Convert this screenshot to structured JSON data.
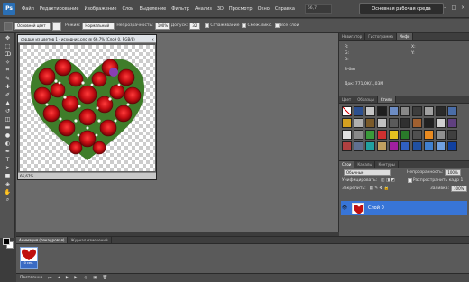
{
  "app": {
    "logo": "Ps"
  },
  "menu": [
    "Файл",
    "Редактирование",
    "Изображение",
    "Слои",
    "Выделение",
    "Фильтр",
    "Анализ",
    "3D",
    "Просмотр",
    "Окно",
    "Справка"
  ],
  "zoom": "66,7",
  "workspace_button": "Основная рабочая среда",
  "options": {
    "mode_preset": "Основной цвет",
    "mode_label": "Режим:",
    "mode_value": "Нормальный",
    "opacity_label": "Непрозрачность:",
    "opacity_value": "100%",
    "tolerance_label": "Допуск:",
    "tolerance_value": "32",
    "antialias": "Сглаживание",
    "contiguous": "Смеж.пикс.",
    "all_layers": "Все слои"
  },
  "document": {
    "title": "сердце из цветов 1 - исходник.png @ 66,7% (Слой 0, RGB/8)",
    "status": "66,67%"
  },
  "info_panel": {
    "tabs": [
      "Навигатор",
      "Гистограмма",
      "Инфо"
    ],
    "r": "R:",
    "g": "G:",
    "b": "B:",
    "bit": "8-бит",
    "x": "X:",
    "y": "Y:",
    "doc": "Док: 771,0K/1,03M"
  },
  "swatches_panel": {
    "tabs": [
      "Цвет",
      "Образцы",
      "Стили"
    ]
  },
  "layers_panel": {
    "tabs": [
      "Слои",
      "Каналы",
      "Контуры"
    ],
    "blend": "Обычные",
    "opacity_label": "Непрозрачность:",
    "opacity_value": "100%",
    "unify_label": "Унифицировать:",
    "propagate": "Распространить кадр 1",
    "lock_label": "Закрепить:",
    "fill_label": "Заливка:",
    "fill_value": "100%",
    "layer_name": "Слой 0"
  },
  "animation_panel": {
    "tabs": [
      "Анимация (покадровая)",
      "Журнал измерений"
    ],
    "frame_label": "0 сек.",
    "loop": "Постоянно"
  },
  "colors": {
    "accent": "#3875d7"
  }
}
